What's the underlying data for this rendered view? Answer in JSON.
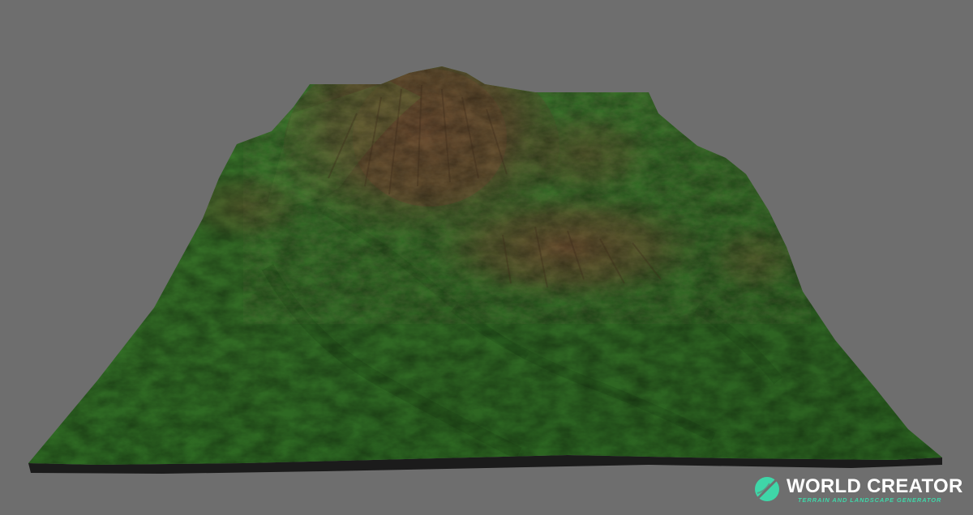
{
  "viewport": {
    "background": "#6e6e6e",
    "terrain": {
      "type": "mountain-heightmap-render",
      "low_color": "#3a7a2a",
      "high_color": "#6b4a2e",
      "base_color": "#1b1b1b"
    }
  },
  "logo": {
    "icon": "world-creator-emblem",
    "title": "WORLD CREATOR",
    "subtitle": "TERRAIN AND LANDSCAPE GENERATOR",
    "accent": "#3fd6a8",
    "title_color": "#ffffff"
  }
}
